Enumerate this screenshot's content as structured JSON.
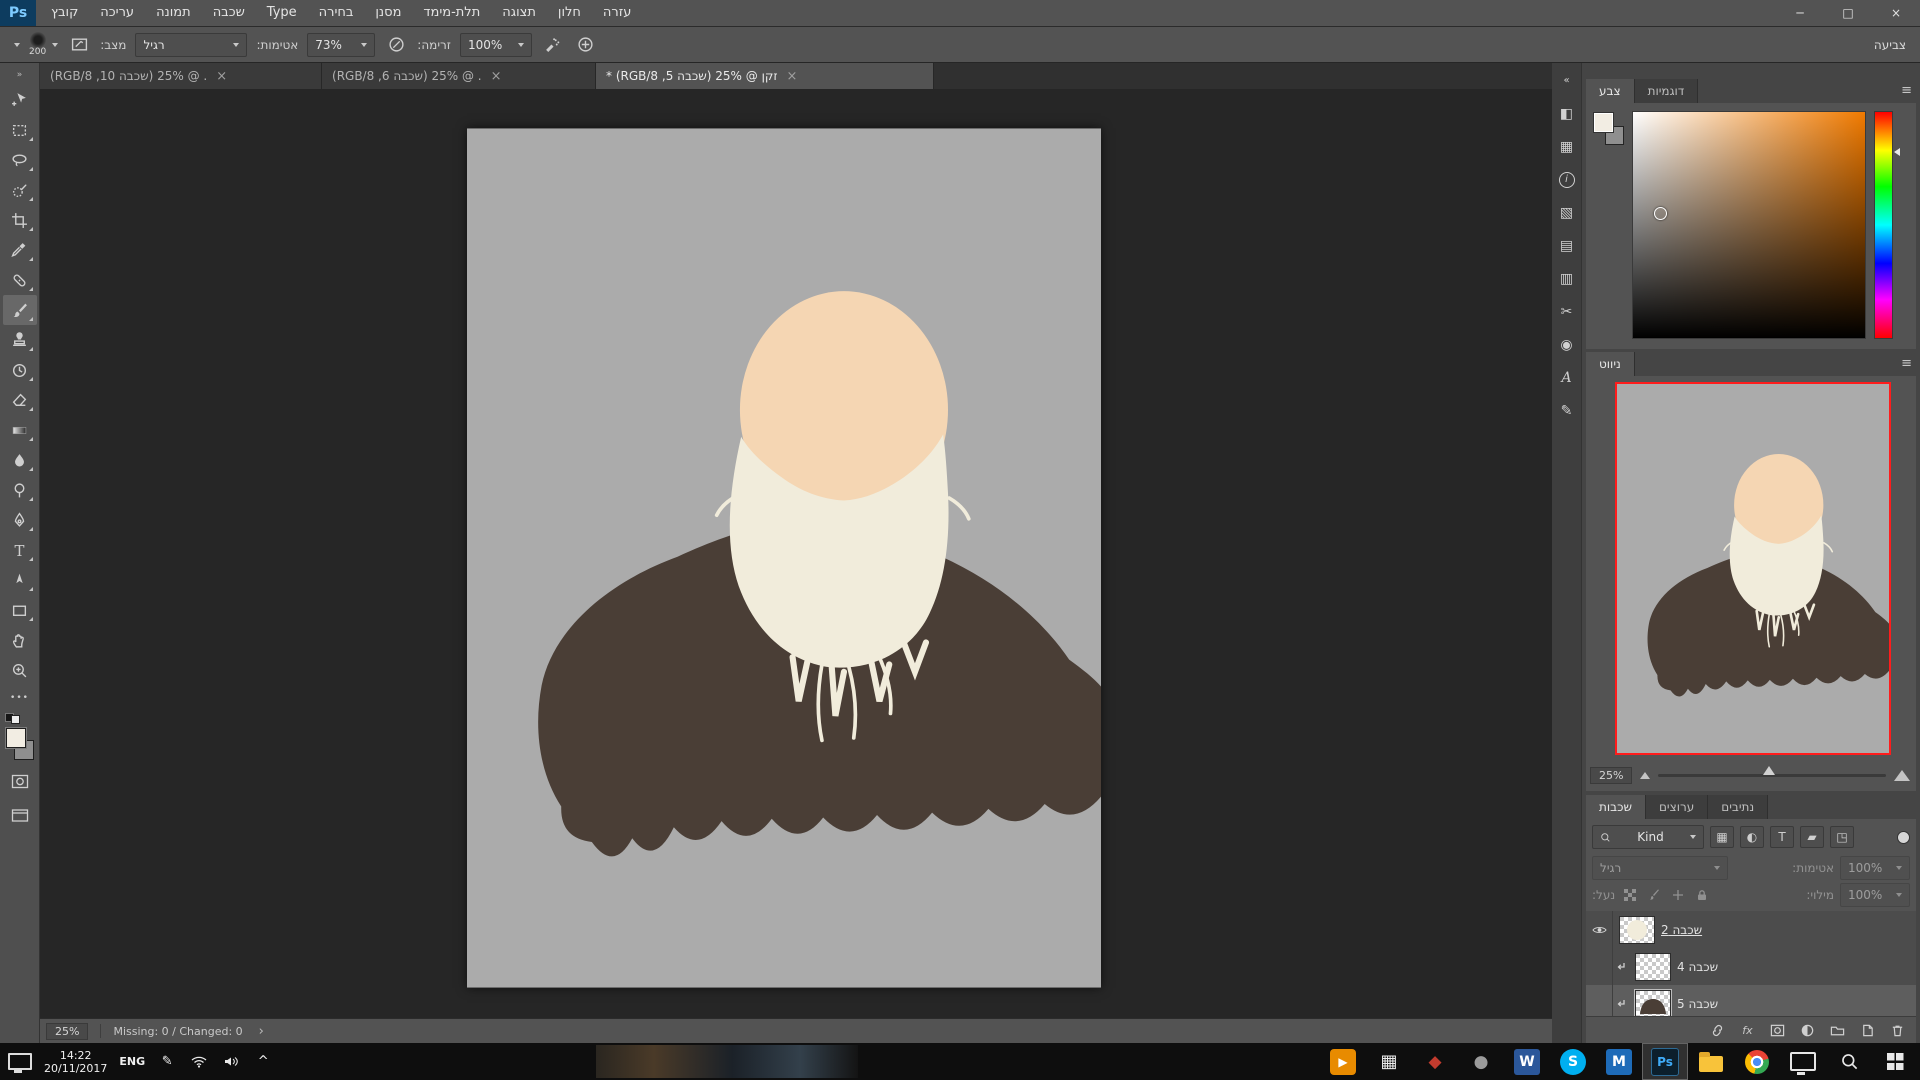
{
  "window": {
    "logo": "Ps",
    "controls": {
      "minimize": "─",
      "maximize": "□",
      "close": "×"
    }
  },
  "menu": {
    "items": [
      "קובץ",
      "עריכה",
      "תמונה",
      "שכבה",
      "Type",
      "בחירה",
      "מסנן",
      "תלת-מימד",
      "תצוגה",
      "חלון",
      "עזרה"
    ]
  },
  "options_bar": {
    "brush_size": "200",
    "mode_label": "מצב:",
    "mode_value": "רגיל",
    "opacity_label": "אטימות:",
    "opacity_value": "73%",
    "flow_label": "זרימה:",
    "flow_value": "100%",
    "workspace_label": "צביעה"
  },
  "document_tabs": [
    {
      "title": ". @ 25% (שכבה 10, RGB/8)",
      "close": "×"
    },
    {
      "title": ". @ 25% (שכבה 6, RGB/8)",
      "close": "×"
    },
    {
      "title": "זקן @ 25% (שכבה 5, RGB/8) *",
      "close": "×"
    }
  ],
  "tools": {
    "selected": "brush",
    "names": [
      "move",
      "rectangular-marquee",
      "lasso",
      "quick-selection",
      "crop",
      "eyedropper",
      "healing-brush",
      "brush",
      "clone-stamp",
      "history-brush",
      "eraser",
      "gradient",
      "blur",
      "dodge",
      "pen",
      "type",
      "path-selection",
      "rectangle",
      "hand",
      "zoom"
    ]
  },
  "icons": {
    "toolbar_collapse": "»",
    "dock_collapse": "«",
    "panel_menu": "≡",
    "ellipsis": "•••",
    "chevron_up": "^",
    "pen_input": "✎",
    "status_expander": "›"
  },
  "panel_dock": {
    "icons": [
      {
        "name": "adjustments",
        "glyph": "◧"
      },
      {
        "name": "histogram",
        "glyph": "▦"
      },
      {
        "name": "info",
        "glyph": "i"
      },
      {
        "name": "properties",
        "glyph": "▧"
      },
      {
        "name": "character",
        "glyph": "▤"
      },
      {
        "name": "paragraph",
        "glyph": "▥"
      },
      {
        "name": "measure",
        "glyph": "✂"
      },
      {
        "name": "clone-source",
        "glyph": "◉"
      },
      {
        "name": "character-styles",
        "glyph": "A"
      },
      {
        "name": "annotate",
        "glyph": "✎"
      }
    ]
  },
  "color_panel": {
    "tab_color": "צבע",
    "tab_swatches": "דוגמיות",
    "hue_color": "#f07a00"
  },
  "navigator": {
    "title": "ניווט",
    "zoom": "25%"
  },
  "layers_panel": {
    "tab_layers": "שכבות",
    "tab_channels": "ערוצים",
    "tab_paths": "נתיבים",
    "filter_label": "Kind",
    "filter_icons": [
      {
        "name": "pixel-layers",
        "glyph": "▦"
      },
      {
        "name": "adjustment-layers",
        "glyph": "◐"
      },
      {
        "name": "type-layers",
        "glyph": "T"
      },
      {
        "name": "shape-layers",
        "glyph": "▰"
      },
      {
        "name": "smart-objects",
        "glyph": "◳"
      }
    ],
    "blend_mode": "רגיל",
    "opacity_label": "אטימות:",
    "opacity_value": "100%",
    "lock_label": "נעל:",
    "lock_icons": [
      "lock-transparency",
      "lock-pixels",
      "lock-position",
      "lock-all"
    ],
    "fill_label": "מילוי:",
    "fill_value": "100%",
    "layers": [
      {
        "name": "שכבה 2",
        "visible": true,
        "selected": false
      },
      {
        "name": "שכבה 4",
        "visible": false,
        "selected": false
      },
      {
        "name": "שכבה 5",
        "visible": false,
        "selected": true
      }
    ],
    "fx_label": "fx"
  },
  "status_bar": {
    "zoom": "25%",
    "message": "Missing: 0 / Changed: 0"
  },
  "taskbar": {
    "time": "14:22",
    "date": "20/11/2017",
    "language": "ENG",
    "apps": [
      {
        "name": "media-player",
        "label": "▶"
      },
      {
        "name": "movies-and-tv",
        "label": "▦"
      },
      {
        "name": "media-app",
        "label": "◆"
      },
      {
        "name": "camera-app",
        "label": "●"
      },
      {
        "name": "word",
        "label": "W"
      },
      {
        "name": "skype",
        "label": "S"
      },
      {
        "name": "app-m",
        "label": "M"
      },
      {
        "name": "photoshop",
        "label": "Ps"
      },
      {
        "name": "file-explorer",
        "label": ""
      },
      {
        "name": "chrome",
        "label": ""
      },
      {
        "name": "computer",
        "label": ""
      },
      {
        "name": "search",
        "label": ""
      },
      {
        "name": "start",
        "label": ""
      }
    ]
  },
  "artwork": {
    "background_color": "#ababab",
    "skin_color": "#f5d6b3",
    "beard_color": "#f1ecdb",
    "coat_color": "#4a3e36"
  }
}
